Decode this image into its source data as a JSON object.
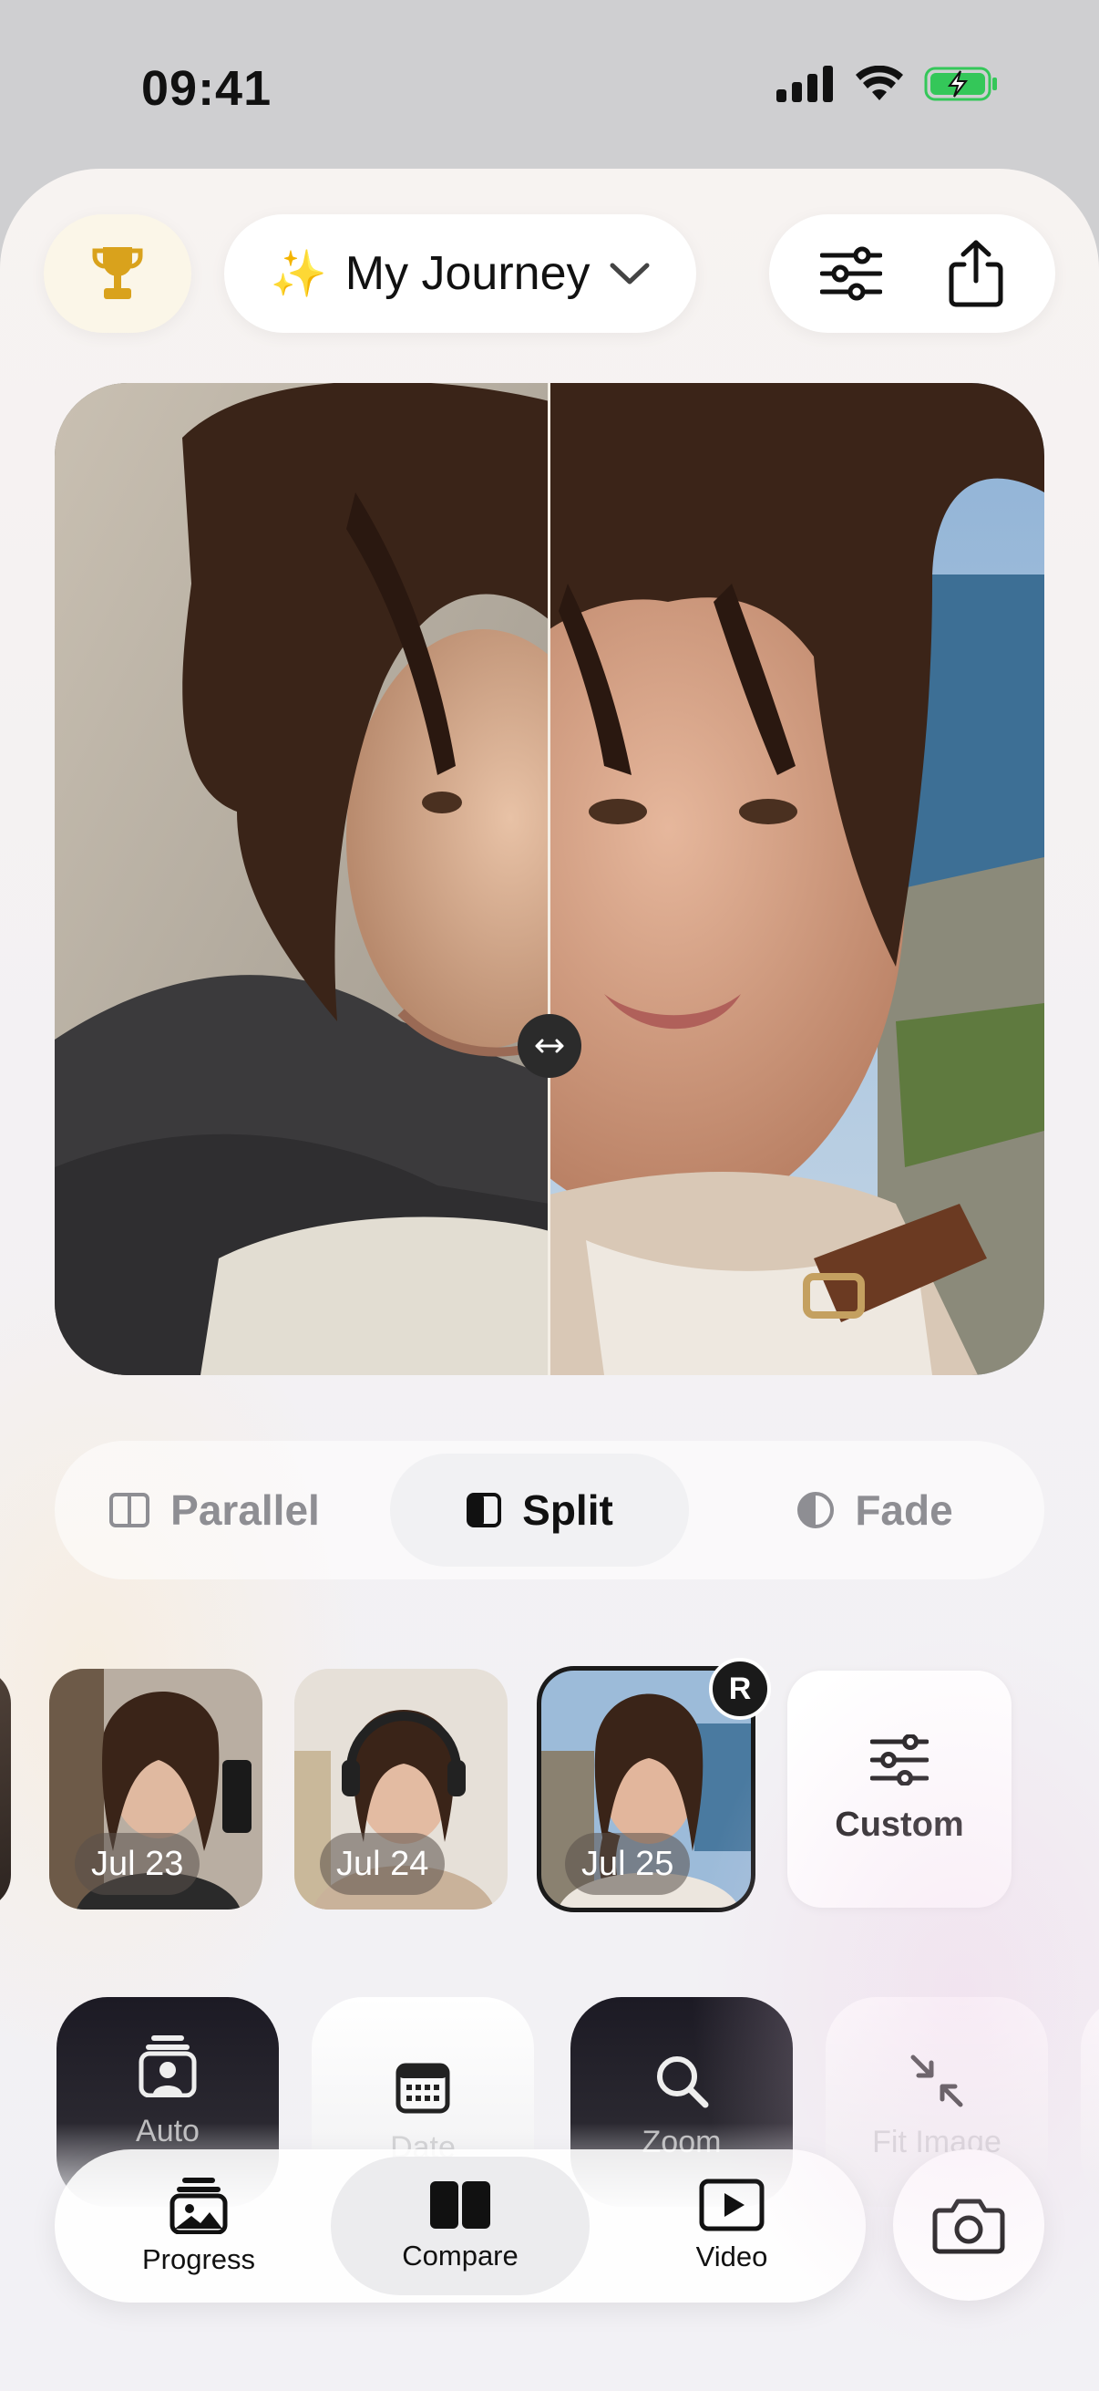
{
  "status_bar": {
    "time": "09:41",
    "icons": [
      "cellular-signal-icon",
      "wifi-icon",
      "battery-charging-icon"
    ]
  },
  "header": {
    "trophy_icon": "trophy-icon",
    "journey": {
      "emoji": "✨",
      "label": "My Journey",
      "icon": "chevron-down-icon"
    },
    "actions": [
      "sliders-icon",
      "share-icon"
    ]
  },
  "comparison": {
    "mode": "split",
    "divider_position": 0.5,
    "left_photo": "older selfie, dark hoodie, indoors",
    "right_photo": "recent selfie, white top, seaside cliffs"
  },
  "modes": [
    {
      "key": "parallel",
      "label": "Parallel",
      "icon": "columns-icon",
      "active": false
    },
    {
      "key": "split",
      "label": "Split",
      "icon": "split-square-icon",
      "active": true
    },
    {
      "key": "fade",
      "label": "Fade",
      "icon": "half-circle-icon",
      "active": false
    }
  ],
  "timeline": {
    "thumbnails": [
      {
        "date": "Jul 23",
        "selected": false
      },
      {
        "date": "Jul 24",
        "selected": false
      },
      {
        "date": "Jul 25",
        "selected": true,
        "badge": "R"
      }
    ],
    "custom": {
      "label": "Custom",
      "icon": "sliders-icon"
    }
  },
  "tools": [
    {
      "label": "Auto",
      "icon": "portrait-stack-icon",
      "style": "dark"
    },
    {
      "label": "Date",
      "icon": "calendar-icon",
      "style": "light"
    },
    {
      "label": "Zoom",
      "icon": "search-icon",
      "style": "dark"
    },
    {
      "label": "Fit Image",
      "icon": "arrows-inward-icon",
      "style": "light"
    }
  ],
  "tabbar": {
    "tabs": [
      {
        "label": "Progress",
        "icon": "photo-stack-icon",
        "active": false
      },
      {
        "label": "Compare",
        "icon": "split-columns-icon",
        "active": true
      },
      {
        "label": "Video",
        "icon": "play-rectangle-icon",
        "active": false
      }
    ],
    "camera_icon": "camera-icon"
  },
  "colors": {
    "accent_gold": "#d9a21c",
    "dark": "#1c1a24",
    "muted": "#8e8e93"
  }
}
